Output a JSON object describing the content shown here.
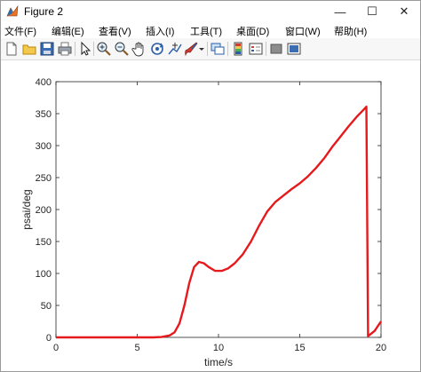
{
  "window": {
    "title": "Figure 2",
    "minimize_glyph": "—",
    "maximize_glyph": "☐",
    "close_glyph": "✕"
  },
  "menu": [
    "文件(F)",
    "编辑(E)",
    "查看(V)",
    "插入(I)",
    "工具(T)",
    "桌面(D)",
    "窗口(W)",
    "帮助(H)"
  ],
  "toolbar_icons": [
    "new-figure-icon",
    "open-file-icon",
    "save-icon",
    "print-icon",
    "edit-plot-arrow-icon",
    "zoom-in-icon",
    "zoom-out-icon",
    "pan-hand-icon",
    "rotate-3d-icon",
    "data-cursor-icon",
    "brush-icon",
    "brush-dropdown-icon",
    "link-plot-icon",
    "insert-colorbar-icon",
    "insert-legend-icon",
    "hide-plot-tools-icon",
    "show-plot-tools-icon"
  ],
  "colors": {
    "line": "#e6191c",
    "axes": "#262626",
    "window_bg": "#f0f0f0"
  },
  "chart_data": {
    "type": "line",
    "xlabel": "time/s",
    "ylabel": "psai/deg",
    "xlim": [
      0,
      20
    ],
    "ylim": [
      0,
      400
    ],
    "xticks": [
      0,
      5,
      10,
      15,
      20
    ],
    "yticks": [
      0,
      50,
      100,
      150,
      200,
      250,
      300,
      350,
      400
    ],
    "grid": false,
    "series": [
      {
        "x": [
          0,
          5,
          6,
          6.5,
          7,
          7.3,
          7.6,
          7.9,
          8.2,
          8.5,
          8.8,
          9.1,
          9.4,
          9.8,
          10.2,
          10.6,
          11,
          11.5,
          12,
          12.5,
          13,
          13.5,
          14,
          14.5,
          15,
          15.5,
          16,
          16.5,
          17,
          17.5,
          18,
          18.5,
          19,
          19.1,
          19.2,
          19.6,
          20
        ],
        "y": [
          0,
          0,
          0,
          0.5,
          3,
          8,
          22,
          50,
          85,
          110,
          118,
          116,
          110,
          104,
          104,
          108,
          116,
          130,
          150,
          175,
          197,
          212,
          222,
          232,
          241,
          252,
          265,
          280,
          298,
          314,
          330,
          345,
          358,
          361,
          2,
          10,
          25
        ]
      }
    ]
  }
}
